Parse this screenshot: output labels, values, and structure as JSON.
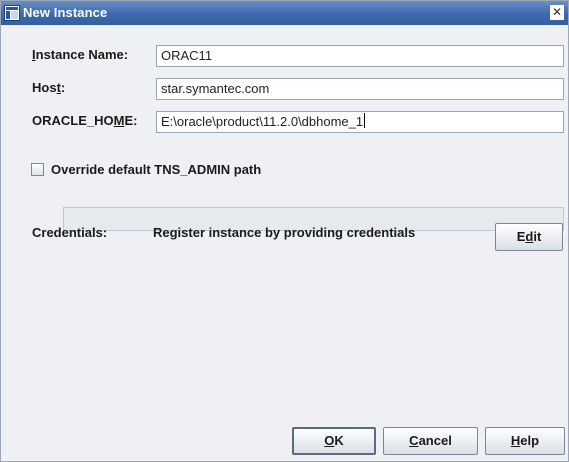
{
  "window": {
    "title": "New Instance",
    "close_glyph": "✕"
  },
  "fields": {
    "instance_name": {
      "label_pre": "",
      "label_mn": "I",
      "label_post": "nstance Name:",
      "value": "ORAC11"
    },
    "host": {
      "label_pre": "Hos",
      "label_mn": "t",
      "label_post": ":",
      "value": "star.symantec.com"
    },
    "oracle_home": {
      "label_pre": "ORACLE_HO",
      "label_mn": "M",
      "label_post": "E:",
      "value": "E:\\oracle\\product\\11.2.0\\dbhome_1"
    }
  },
  "override": {
    "checked": false,
    "label": "Override default TNS_ADMIN path",
    "path_value": ""
  },
  "credentials": {
    "label": "Credentials:",
    "value": "Register instance by providing credentials",
    "edit_pre": "E",
    "edit_mn": "d",
    "edit_post": "it"
  },
  "buttons": {
    "ok": {
      "pre": "",
      "mn": "O",
      "post": "K"
    },
    "cancel": {
      "pre": "",
      "mn": "C",
      "post": "ancel"
    },
    "help": {
      "pre": "",
      "mn": "H",
      "post": "elp"
    }
  },
  "colors": {
    "title_bar": "#3f6cb0",
    "dialog_bg": "#eef0f3"
  }
}
